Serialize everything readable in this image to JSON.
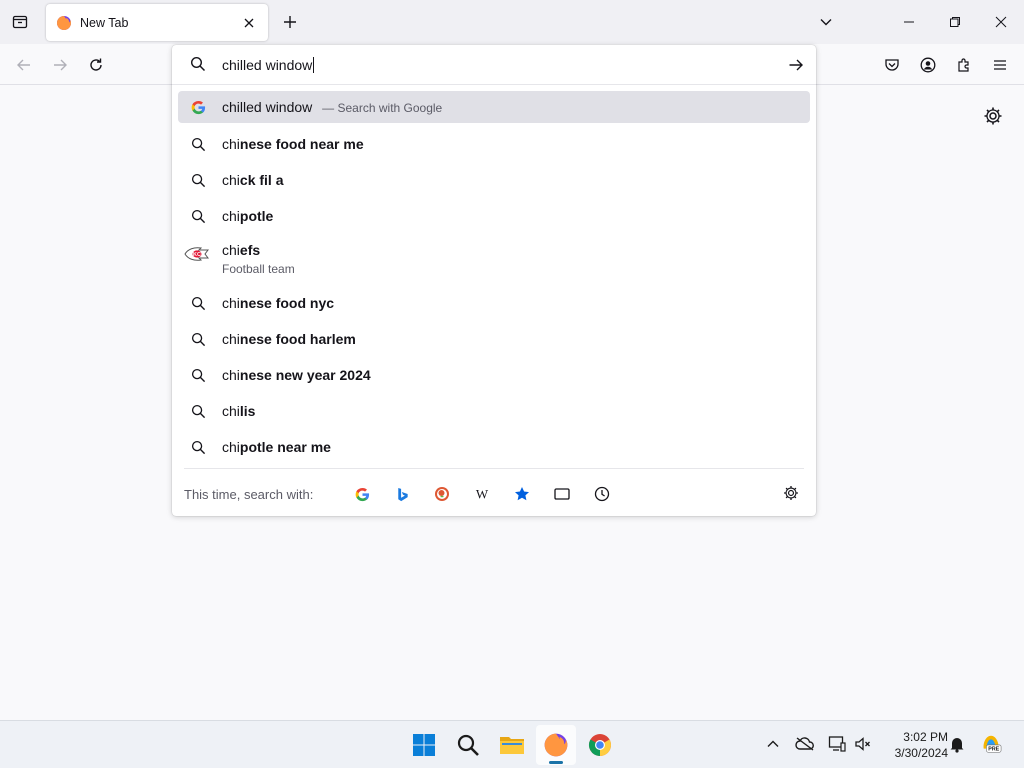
{
  "tab": {
    "title": "New Tab"
  },
  "urlbar": {
    "value": "chilled window"
  },
  "results": [
    {
      "prefix": "chilled window",
      "bold": "",
      "suffix": "— Search with Google",
      "icon": "google-icon"
    },
    {
      "prefix": "chi",
      "bold": "nese food near me",
      "icon": "search-icon"
    },
    {
      "prefix": "chi",
      "bold": "ck fil a",
      "icon": "search-icon"
    },
    {
      "prefix": "chi",
      "bold": "potle",
      "icon": "search-icon"
    },
    {
      "prefix": "chi",
      "bold": "efs",
      "desc": "Football team",
      "icon": "chiefs-logo-icon"
    },
    {
      "prefix": "chi",
      "bold": "nese food nyc",
      "icon": "search-icon"
    },
    {
      "prefix": "chi",
      "bold": "nese food harlem",
      "icon": "search-icon"
    },
    {
      "prefix": "chi",
      "bold": "nese new year 2024",
      "icon": "search-icon"
    },
    {
      "prefix": "chi",
      "bold": "lis",
      "icon": "search-icon"
    },
    {
      "prefix": "chi",
      "bold": "potle near me",
      "icon": "search-icon"
    }
  ],
  "oneoff": {
    "label": "This time, search with:",
    "engines": [
      "google-icon",
      "bing-icon",
      "duckduckgo-icon",
      "wikipedia-icon",
      "bookmarks-star-icon",
      "tabs-icon",
      "history-clock-icon"
    ]
  },
  "clock": {
    "time": "3:02 PM",
    "date": "3/30/2024"
  },
  "colors": {
    "accent": "#0060df",
    "selected_row": "#e0e0e6",
    "taskbar": "#eef1f6"
  }
}
